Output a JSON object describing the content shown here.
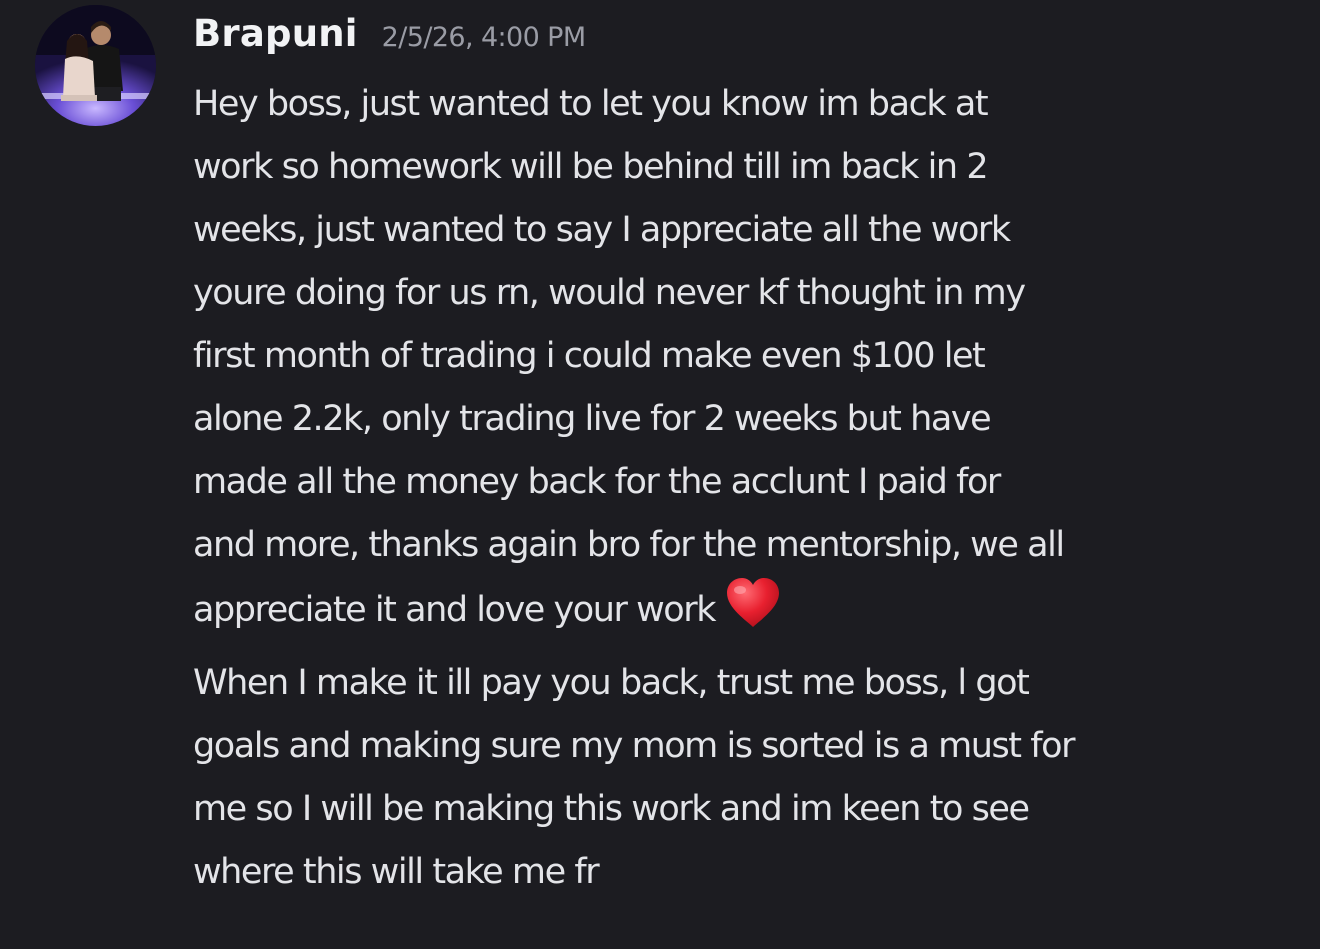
{
  "message": {
    "author": "Brapuni",
    "timestamp": "2/5/26, 4:00 PM",
    "paragraphs": [
      {
        "lines": [
          "Hey boss, just wanted to let you know im back at",
          "work so homework will be behind till im back in 2",
          "weeks, just wanted to say I appreciate all the work",
          "youre doing for us rn, would never kf thought in my",
          "first month of trading i could make even $100 let",
          "alone 2.2k, only trading live for 2 weeks but have",
          "made all the money back for the acclunt I paid for",
          "and more, thanks again bro for the mentorship, we all",
          "appreciate it and love your work"
        ],
        "trailing_emoji": "heart-emoji"
      },
      {
        "lines": [
          "When I make it ill pay you back, trust me boss, l got",
          "goals and making sure my mom is sorted is a must for",
          "me so I will be making this work and im keen to see",
          "where this will take me fr"
        ]
      }
    ]
  },
  "colors": {
    "background": "#1c1c21",
    "username": "#f2f3f5",
    "timestamp": "#9a9ca5",
    "message_text": "#e3e4e8",
    "heart": "#e8202f"
  }
}
